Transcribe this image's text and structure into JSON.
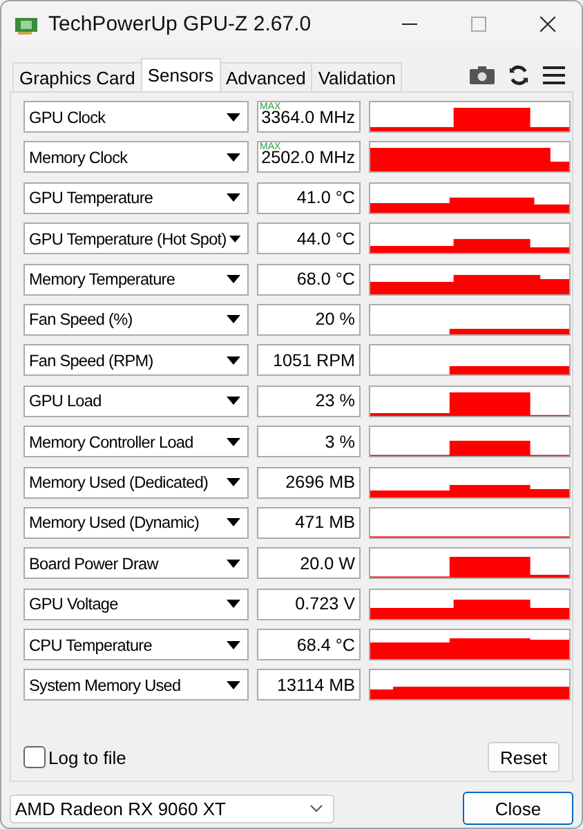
{
  "window": {
    "title": "TechPowerUp GPU-Z 2.67.0"
  },
  "tabs": [
    {
      "label": "Graphics Card",
      "selected": false
    },
    {
      "label": "Sensors",
      "selected": true
    },
    {
      "label": "Advanced",
      "selected": false
    },
    {
      "label": "Validation",
      "selected": false
    }
  ],
  "sensors": [
    {
      "name": "GPU Clock",
      "value": "3364.0 MHz",
      "badge": "MAX"
    },
    {
      "name": "Memory Clock",
      "value": "2502.0 MHz",
      "badge": "MAX"
    },
    {
      "name": "GPU Temperature",
      "value": "41.0 °C"
    },
    {
      "name": "GPU Temperature (Hot Spot)",
      "value": "44.0 °C"
    },
    {
      "name": "Memory Temperature",
      "value": "68.0 °C"
    },
    {
      "name": "Fan Speed (%)",
      "value": "20 %"
    },
    {
      "name": "Fan Speed (RPM)",
      "value": "1051 RPM"
    },
    {
      "name": "GPU Load",
      "value": "23 %"
    },
    {
      "name": "Memory Controller Load",
      "value": "3 %"
    },
    {
      "name": "Memory Used (Dedicated)",
      "value": "2696 MB"
    },
    {
      "name": "Memory Used (Dynamic)",
      "value": "471 MB"
    },
    {
      "name": "Board Power Draw",
      "value": "20.0 W"
    },
    {
      "name": "GPU Voltage",
      "value": "0.723 V"
    },
    {
      "name": "CPU Temperature",
      "value": "68.4 °C"
    },
    {
      "name": "System Memory Used",
      "value": "13114 MB"
    }
  ],
  "log_to_file": {
    "label": "Log to file",
    "checked": false
  },
  "reset_button": "Reset",
  "gpu_select": {
    "value": "AMD Radeon RX 9060 XT"
  },
  "close_button": "Close"
}
